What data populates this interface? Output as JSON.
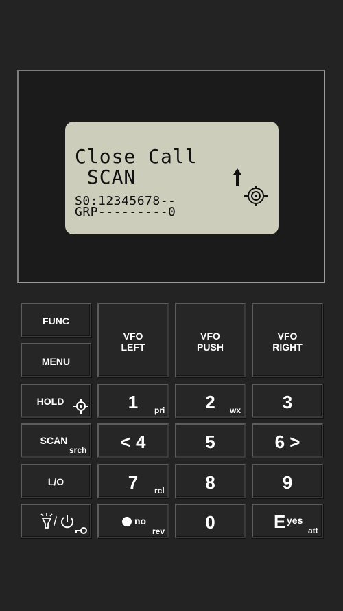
{
  "display": {
    "line1": "Close Call",
    "line2": " SCAN",
    "line3": "S0:12345678--",
    "line4": "GRP---------0",
    "up_arrow_icon": "up-arrow-icon",
    "close_call_icon": "close-call-icon"
  },
  "keys": {
    "func": "FUNC",
    "menu": "MENU",
    "vfo_left": [
      "VFO",
      "LEFT"
    ],
    "vfo_push": [
      "VFO",
      "PUSH"
    ],
    "vfo_right": [
      "VFO",
      "RIGHT"
    ],
    "hold": "HOLD",
    "k1": {
      "main": "1",
      "sub": "pri"
    },
    "k2": {
      "main": "2",
      "sub": "wx"
    },
    "k3": {
      "main": "3"
    },
    "scan": {
      "main": "SCAN",
      "sub": "srch"
    },
    "k4": {
      "main": "< 4"
    },
    "k5": {
      "main": "5"
    },
    "k6": {
      "main": "6 >"
    },
    "lo": "L/O",
    "k7": {
      "main": "7",
      "sub": "rcl"
    },
    "k8": {
      "main": "8"
    },
    "k9": {
      "main": "9"
    },
    "light_power": "/",
    "dot_no": {
      "main": "no",
      "sub": "rev"
    },
    "k0": {
      "main": "0"
    },
    "e_yes": {
      "main": "E",
      "sup": "yes",
      "sub": "att"
    }
  },
  "colors": {
    "background": "#232323",
    "lcd": "#cdcdbc",
    "key": "#262626"
  }
}
